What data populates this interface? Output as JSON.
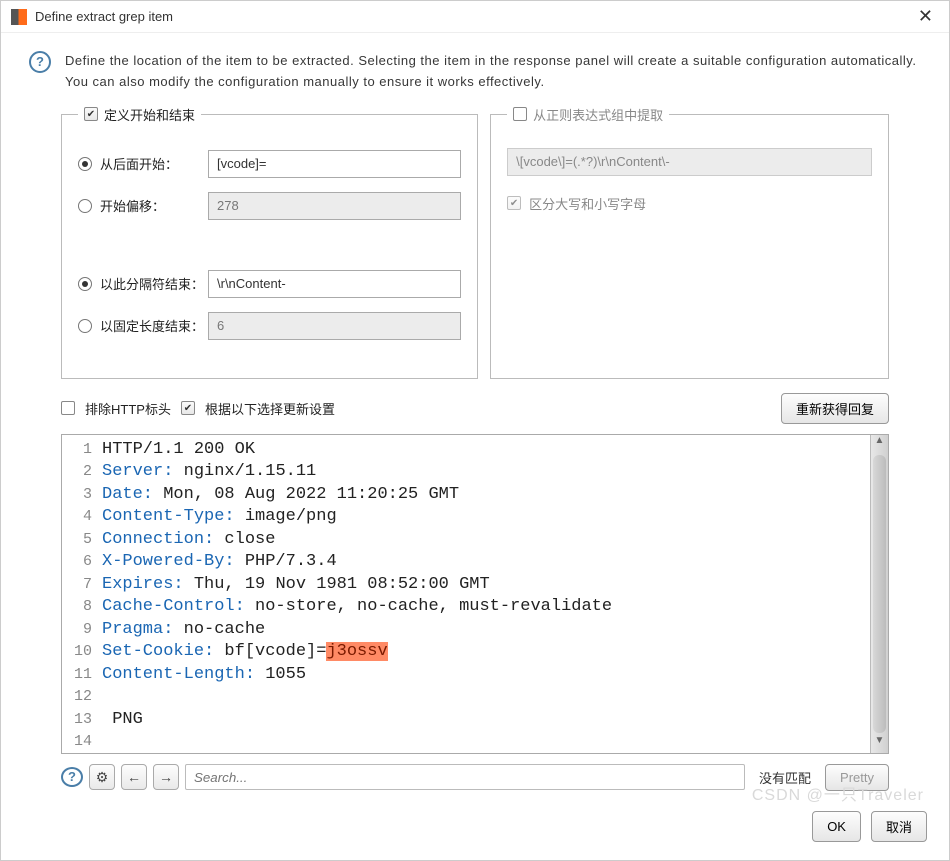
{
  "title": "Define extract grep item",
  "description": "Define the location of the item to be extracted. Selecting the item in the response panel will create a suitable configuration automatically. You can also modify the configuration manually to ensure it works effectively.",
  "left_panel": {
    "legend": "定义开始和结束",
    "start_after_label": "从后面开始：",
    "start_after_value": "[vcode]=",
    "start_offset_label": "开始偏移：",
    "start_offset_value": "278",
    "end_delim_label": "以此分隔符结束：",
    "end_delim_value": "\\r\\nContent-",
    "end_fixed_label": "以固定长度结束：",
    "end_fixed_value": "6"
  },
  "right_panel": {
    "legend": "从正则表达式组中提取",
    "regex": "\\[vcode\\]=(.*?)\\r\\nContent\\-",
    "case_label": "区分大写和小写字母"
  },
  "midbar": {
    "exclude_headers": "排除HTTP标头",
    "update_config": "根据以下选择更新设置",
    "refetch": "重新获得回复"
  },
  "response": {
    "lines": [
      {
        "n": 1,
        "plain": "HTTP/1.1 200 OK"
      },
      {
        "n": 2,
        "h": "Server:",
        "v": " nginx/1.15.11"
      },
      {
        "n": 3,
        "h": "Date:",
        "v": " Mon, 08 Aug 2022 11:20:25 GMT"
      },
      {
        "n": 4,
        "h": "Content-Type:",
        "v": " image/png"
      },
      {
        "n": 5,
        "h": "Connection:",
        "v": " close"
      },
      {
        "n": 6,
        "h": "X-Powered-By:",
        "v": " PHP/7.3.4"
      },
      {
        "n": 7,
        "h": "Expires:",
        "v": " Thu, 19 Nov 1981 08:52:00 GMT"
      },
      {
        "n": 8,
        "h": "Cache-Control:",
        "v": " no-store, no-cache, must-revalidate"
      },
      {
        "n": 9,
        "h": "Pragma:",
        "v": " no-cache"
      },
      {
        "n": 10,
        "h": "Set-Cookie:",
        "v": " bf[vcode]=",
        "hl": "j3ossv"
      },
      {
        "n": 11,
        "h": "Content-Length:",
        "v": " 1055"
      },
      {
        "n": 12,
        "plain": ""
      },
      {
        "n": 13,
        "plain": " PNG"
      },
      {
        "n": 14,
        "plain": ""
      }
    ]
  },
  "toolbar": {
    "search_placeholder": "Search...",
    "no_match": "没有匹配",
    "pretty": "Pretty"
  },
  "footer": {
    "ok": "OK",
    "cancel": "取消"
  },
  "watermark": "CSDN @一只Traveler"
}
